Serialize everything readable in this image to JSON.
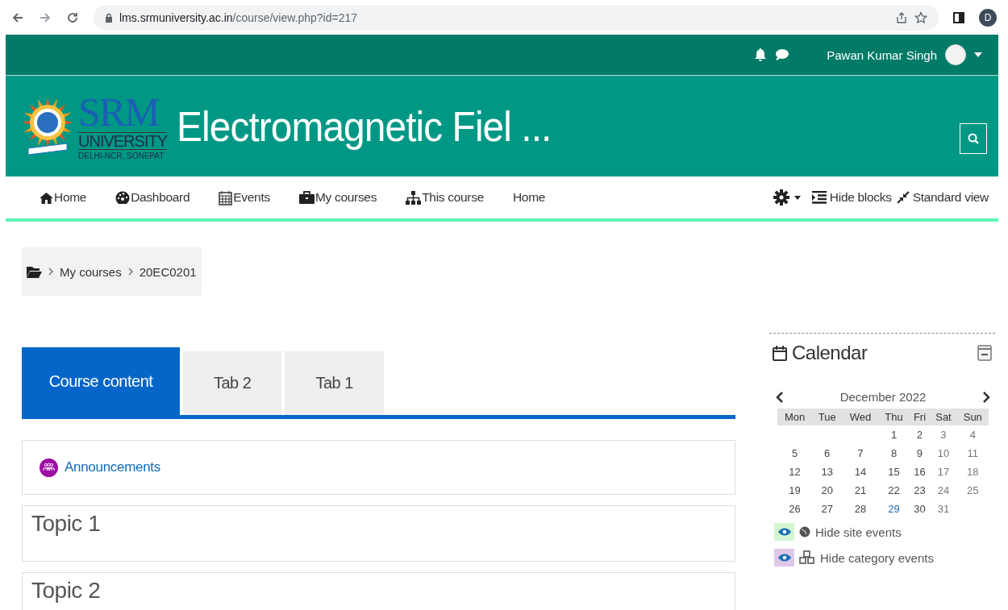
{
  "browser": {
    "url_host": "lms.srmuniversity.ac.in",
    "url_path": "/course/view.php?id=217",
    "profile_initial": "D"
  },
  "topbar": {
    "user_name": "Pawan Kumar Singh"
  },
  "header": {
    "logo": {
      "name": "SRM",
      "line1": "UNIVERSITY",
      "line2": "DELHI-NCR, SONEPAT"
    },
    "course_title": "Electromagnetic Fiel ..."
  },
  "nav": {
    "items": [
      {
        "kind": "home",
        "label": "Home"
      },
      {
        "kind": "dashboard",
        "label": "Dashboard"
      },
      {
        "kind": "events",
        "label": "Events"
      },
      {
        "kind": "courses",
        "label": "My courses"
      },
      {
        "kind": "course",
        "label": "This course"
      },
      {
        "kind": "plain",
        "label": "Home"
      }
    ],
    "tools": [
      {
        "kind": "blocks",
        "label": "Hide blocks"
      },
      {
        "kind": "view",
        "label": "Standard view"
      }
    ]
  },
  "breadcrumb": {
    "items": [
      "My courses",
      "20EC0201"
    ]
  },
  "tabs": [
    {
      "label": "Course content",
      "selected": true
    },
    {
      "label": "Tab 2",
      "selected": false
    },
    {
      "label": "Tab 1",
      "selected": false
    }
  ],
  "sections": [
    {
      "kind": "activity",
      "label": "Announcements"
    },
    {
      "kind": "topic",
      "title": "Topic 1"
    },
    {
      "kind": "topic",
      "title": "Topic 2"
    }
  ],
  "calendar": {
    "title": "Calendar",
    "month": "December 2022",
    "weekdays": [
      "Mon",
      "Tue",
      "Wed",
      "Thu",
      "Fri",
      "Sat",
      "Sun"
    ],
    "weeks": [
      [
        {
          "day": "1",
          "event": false
        },
        {
          "day": "2",
          "event": false
        },
        {
          "day": "3",
          "event": false
        },
        {
          "day": "4",
          "event": false
        }
      ],
      [
        {
          "day": "5",
          "event": false
        },
        {
          "day": "6",
          "event": false
        },
        {
          "day": "7",
          "event": false
        },
        {
          "day": "8",
          "event": false
        },
        {
          "day": "9",
          "event": false
        },
        {
          "day": "10",
          "event": false
        },
        {
          "day": "11",
          "event": false
        }
      ],
      [
        {
          "day": "12",
          "event": false
        },
        {
          "day": "13",
          "event": false
        },
        {
          "day": "14",
          "event": false
        },
        {
          "day": "15",
          "event": false
        },
        {
          "day": "16",
          "event": false
        },
        {
          "day": "17",
          "event": false
        },
        {
          "day": "18",
          "event": false
        }
      ],
      [
        {
          "day": "19",
          "event": false
        },
        {
          "day": "20",
          "event": false
        },
        {
          "day": "21",
          "event": false
        },
        {
          "day": "22",
          "event": false
        },
        {
          "day": "23",
          "event": false
        },
        {
          "day": "24",
          "event": false
        },
        {
          "day": "25",
          "event": false
        }
      ],
      [
        {
          "day": "26",
          "event": false
        },
        {
          "day": "27",
          "event": false
        },
        {
          "day": "28",
          "event": false
        },
        {
          "day": "29",
          "event": true
        },
        {
          "day": "30",
          "event": false
        },
        {
          "day": "31",
          "event": false
        }
      ]
    ],
    "filters": [
      {
        "kind": "site",
        "label": "Hide site events",
        "color": "#d4f5d0"
      },
      {
        "kind": "category",
        "label": "Hide category events",
        "color": "#e0c8e8"
      }
    ]
  }
}
